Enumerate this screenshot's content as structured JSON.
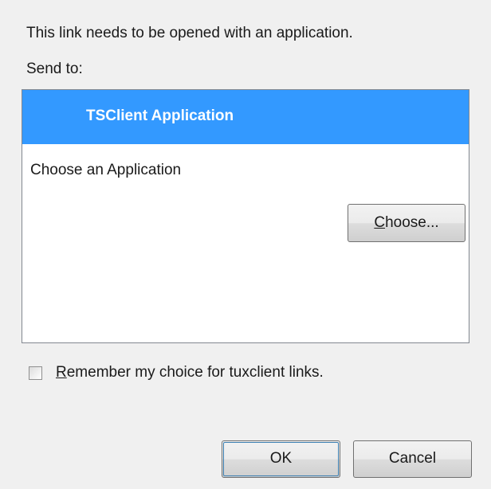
{
  "dialog": {
    "intro": "This link needs to be opened with an application.",
    "send_to_label": "Send to:"
  },
  "app_list": {
    "items": [
      {
        "label": "TSClient Application",
        "selected": true
      },
      {
        "label": "Choose an Application",
        "button": {
          "mnemonic": "C",
          "rest": "hoose..."
        }
      }
    ]
  },
  "remember": {
    "mnemonic": "R",
    "rest": "emember my choice for tuxclient links.",
    "checked": false
  },
  "buttons": {
    "ok": "OK",
    "cancel": "Cancel"
  },
  "colors": {
    "selection": "#3399ff",
    "background": "#f0f0f0"
  }
}
